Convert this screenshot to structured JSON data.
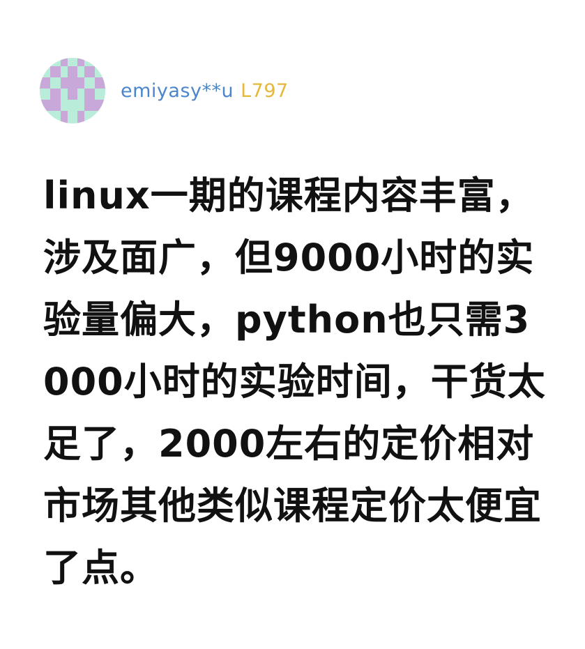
{
  "user": {
    "name": "emiyasy**u",
    "level": "L797",
    "avatar_colors": {
      "primary": "#c8a8d8",
      "secondary": "#b9ecd9"
    }
  },
  "comment": {
    "text": "linux一期的课程内容丰富，涉及面广，但9000小时的实验量偏大，python也只需3000小时的实验时间，干货太足了，2000左右的定价相对市场其他类似课程定价太便宜了点。"
  },
  "colors": {
    "username": "#4a86c9",
    "level": "#e5b73b",
    "text": "#111111",
    "background": "#ffffff"
  }
}
